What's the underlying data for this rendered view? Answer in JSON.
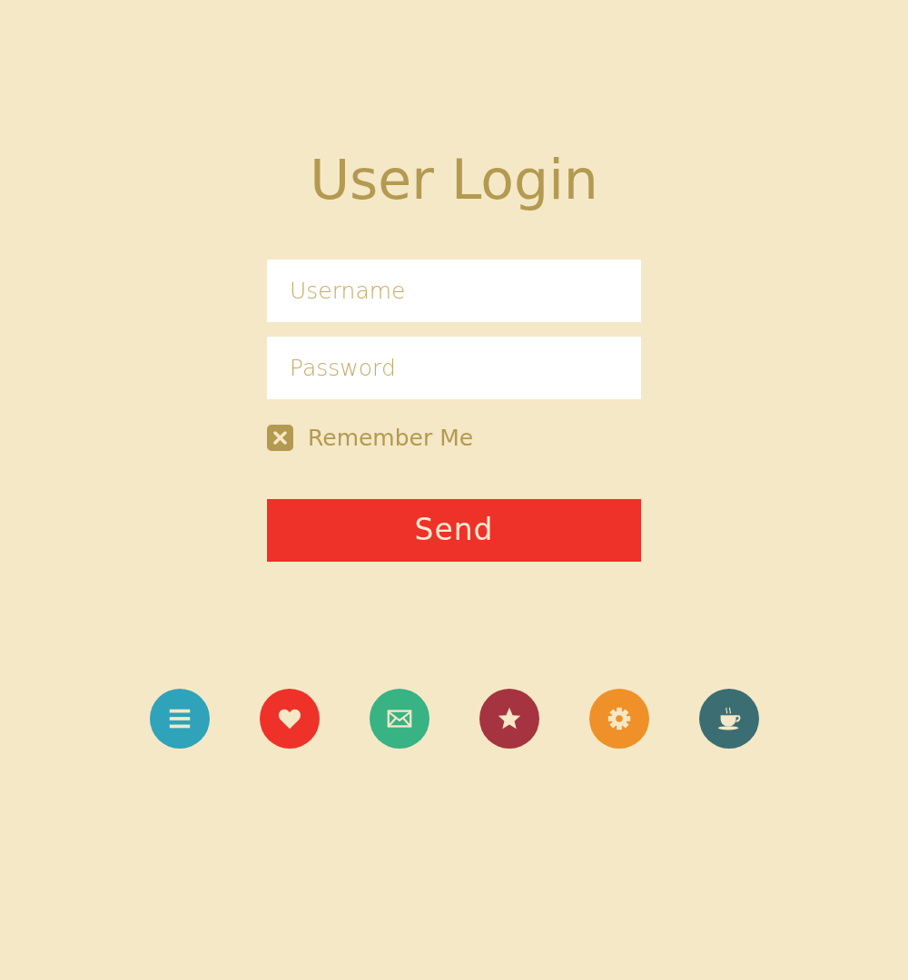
{
  "title": "User Login",
  "fields": [
    {
      "placeholder": "Username"
    },
    {
      "placeholder": "Password"
    }
  ],
  "remember": {
    "label": "Remember Me",
    "checked": true
  },
  "submit": {
    "label": "Send"
  },
  "icon_buttons": [
    {
      "color": "#2ea3ba"
    },
    {
      "color": "#ee3229"
    },
    {
      "color": "#37b384"
    },
    {
      "color": "#a63440"
    },
    {
      "color": "#ef9128"
    },
    {
      "color": "#3a6e72"
    }
  ]
}
